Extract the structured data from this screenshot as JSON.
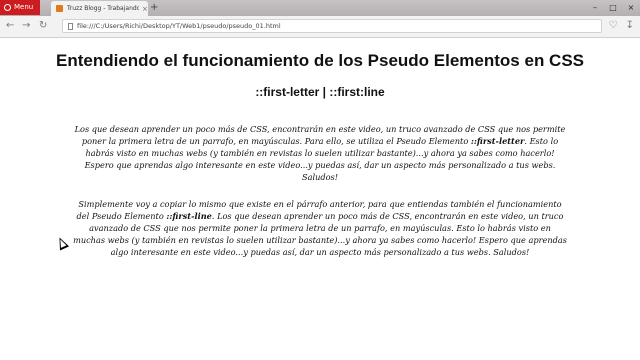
{
  "browser": {
    "menu_label": "Menu",
    "tab_title": "Truzz Blogg - Trabajando c",
    "tab_close": "×",
    "new_tab": "+",
    "url": "file:///C:/Users/Richi/Desktop/YT/Web1/pseudo/pseudo_01.html",
    "window_controls": [
      "–",
      "□",
      "×"
    ]
  },
  "page": {
    "title": "Entendiendo el funcionamiento de los Pseudo Elementos en CSS",
    "subtitle": "::first-letter | ::first:line",
    "paragraph1": {
      "a": "Los que desean aprender un poco más de CSS, encontrarán en este video, un truco avanzado de CSS que nos permite poner la primera letra de un parrafo, en mayúsculas. Para ello, se utiliza el Pseudo Elemento ",
      "bold": "::first-letter",
      "b": ". Esto lo habrás visto en muchas webs (y también en revistas lo suelen utilizar bastante)...y ahora ya sabes como hacerlo! Espero que aprendas algo interesante en este video...y puedas así, dar un aspecto más personalizado a tus webs. Saludos!"
    },
    "paragraph2": {
      "a": "Simplemente voy a copiar lo mismo que existe en el párrafo anterior, para que entiendas también el funcionamiento del Pseudo Elemento ",
      "bold": "::first-line",
      "b": ". Los que desean aprender un poco más de CSS, encontrarán en este video, un truco avanzado de CSS que nos permite poner la primera letra de un parrafo, en mayúsculas. Esto lo habrás visto en muchas webs (y también en revistas lo suelen utilizar bastante)...y ahora ya sabes como hacerlo! Espero que aprendas algo interesante en este video...y puedas así, dar un aspecto más personalizado a tus webs. Saludos!"
    }
  }
}
